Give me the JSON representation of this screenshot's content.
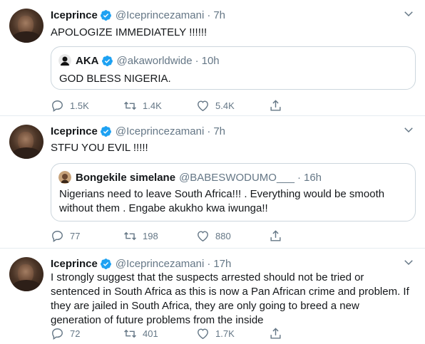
{
  "tweets": [
    {
      "name": "Iceprince",
      "handle": "@Iceprincezamani",
      "dot": "·",
      "time": "7h",
      "text": "APOLOGIZE IMMEDIATELY !!!!!!",
      "quote": {
        "name": "AKA",
        "handle": "@akaworldwide",
        "dot": "·",
        "time": "10h",
        "text": "GOD BLESS NIGERIA."
      },
      "replies": "1.5K",
      "retweets": "1.4K",
      "likes": "5.4K"
    },
    {
      "name": "Iceprince",
      "handle": "@Iceprincezamani",
      "dot": "·",
      "time": "7h",
      "text": "STFU YOU EVIL !!!!!",
      "quote": {
        "name": "Bongekile simelane",
        "handle": "@BABESWODUMO___",
        "dot": "·",
        "time": "16h",
        "text": "Nigerians need to leave South Africa!!! . Everything would be smooth without them . Engabe akukho kwa iwunga!!"
      },
      "replies": "77",
      "retweets": "198",
      "likes": "880"
    },
    {
      "name": "Iceprince",
      "handle": "@Iceprincezamani",
      "dot": "·",
      "time": "17h",
      "text": "I strongly suggest that the suspects arrested should not be tried or sentenced in South Africa as this is now a Pan African crime and problem. If they are jailed in South Africa, they are only going to breed a new generation of future problems from the inside",
      "replies": "72",
      "retweets": "401",
      "likes": "1.7K"
    }
  ],
  "icons": {
    "verified": "verified-badge-icon",
    "caret": "chevron-down-icon",
    "reply": "reply-icon",
    "retweet": "retweet-icon",
    "like": "heart-icon",
    "share": "share-icon"
  },
  "colors": {
    "accent": "#1da1f2",
    "text": "#14171a",
    "secondary": "#657786",
    "border": "#e6ecf0"
  }
}
